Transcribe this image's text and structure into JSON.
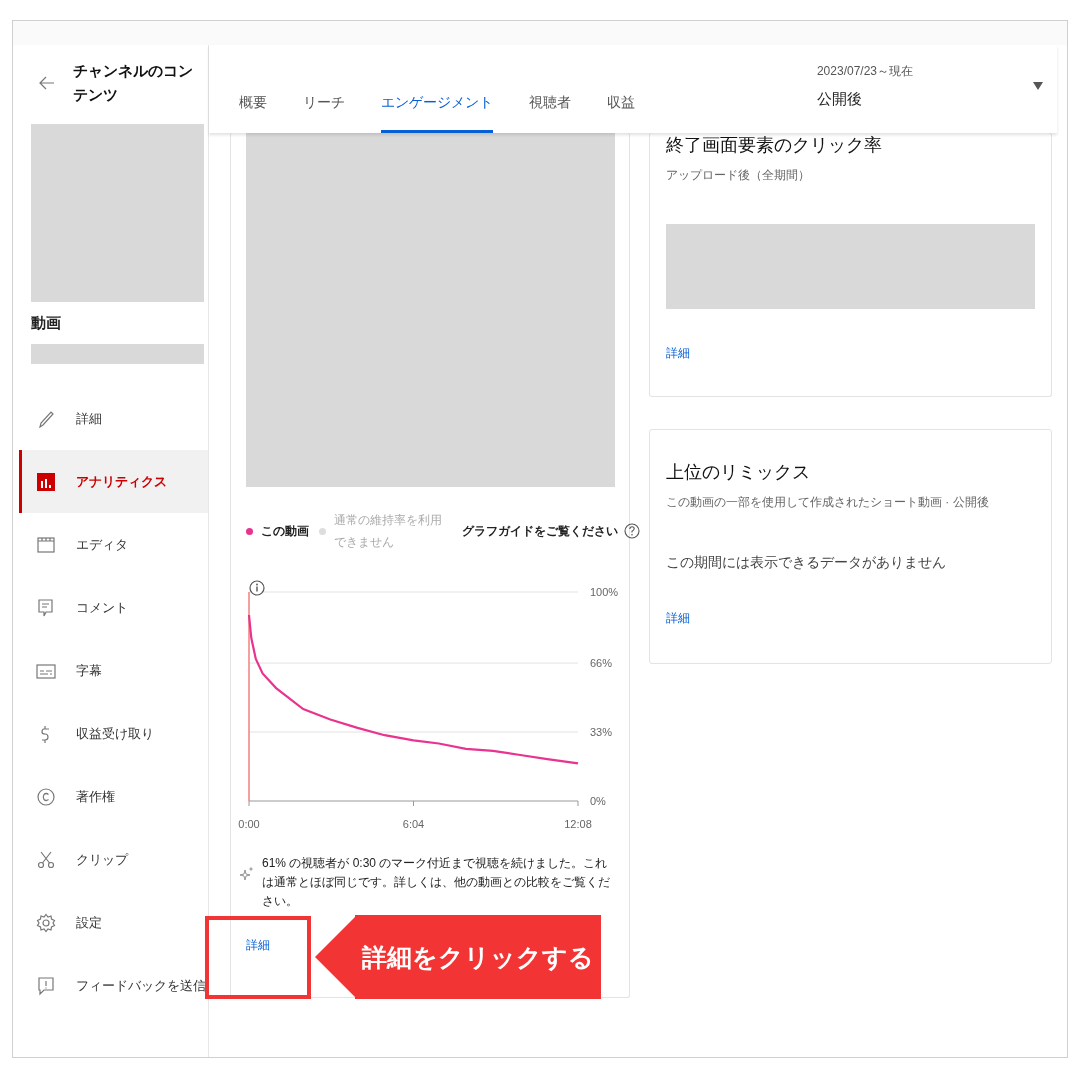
{
  "sidebar": {
    "title": "チャンネルのコンテンツ",
    "video_label": "動画",
    "items": [
      {
        "label": "詳細",
        "selected": false
      },
      {
        "label": "アナリティクス",
        "selected": true
      },
      {
        "label": "エディタ",
        "selected": false
      },
      {
        "label": "コメント",
        "selected": false
      },
      {
        "label": "字幕",
        "selected": false
      },
      {
        "label": "収益受け取り",
        "selected": false
      },
      {
        "label": "著作権",
        "selected": false
      },
      {
        "label": "クリップ",
        "selected": false
      },
      {
        "label": "設定",
        "selected": false
      },
      {
        "label": "フィードバックを送信",
        "selected": false
      }
    ]
  },
  "header": {
    "tabs": [
      {
        "label": "概要",
        "selected": false
      },
      {
        "label": "リーチ",
        "selected": false
      },
      {
        "label": "エンゲージメント",
        "selected": true
      },
      {
        "label": "視聴者",
        "selected": false
      },
      {
        "label": "収益",
        "selected": false
      }
    ],
    "date_range": {
      "period": "2023/07/23～現在",
      "label": "公開後"
    }
  },
  "retention_card": {
    "legend": [
      {
        "label": "通常の維持率を利用できません",
        "color": "#dddddd",
        "disabled": true
      }
    ],
    "guide_link": "グラフガイドをご覧ください",
    "chart_data": {
      "type": "line",
      "x": [
        0,
        5,
        15,
        30,
        60,
        120,
        180,
        240,
        300,
        364,
        420,
        480,
        540,
        600,
        660,
        728
      ],
      "series": [
        {
          "name": "この動画",
          "color": "#e8348f",
          "values": [
            89,
            78,
            68,
            61,
            54,
            44,
            39,
            35,
            31.5,
            29,
            27.5,
            25,
            24,
            22,
            20,
            18
          ]
        }
      ],
      "xlim": [
        0,
        728
      ],
      "ylim": [
        0,
        100
      ],
      "xticks": [
        {
          "value": 0,
          "label": "0:00"
        },
        {
          "value": 364,
          "label": "6:04"
        },
        {
          "value": 728,
          "label": "12:08"
        }
      ],
      "yticks": [
        {
          "value": 0,
          "label": "0%"
        },
        {
          "value": 33,
          "label": "33%"
        },
        {
          "value": 66,
          "label": "66%"
        },
        {
          "value": 100,
          "label": "100%"
        }
      ]
    },
    "insight": "61% の視聴者が 0:30 のマーク付近まで視聴を続けました。これは通常とほぼ同じです。詳しくは、他の動画との比較をご覧ください。",
    "details_link": "詳細"
  },
  "cards": [
    {
      "title": "終了画面要素のクリック率",
      "subtitle": "アップロード後（全期間）",
      "redacted": true,
      "details_link": "詳細"
    },
    {
      "title": "上位のリミックス",
      "subtitle": "この動画の一部を使用して作成されたショート動画 · 公開後",
      "redacted": false,
      "message": "この期間には表示できるデータがありません",
      "details_link": "詳細"
    }
  ],
  "annotation": {
    "label": "詳細をクリックする"
  }
}
